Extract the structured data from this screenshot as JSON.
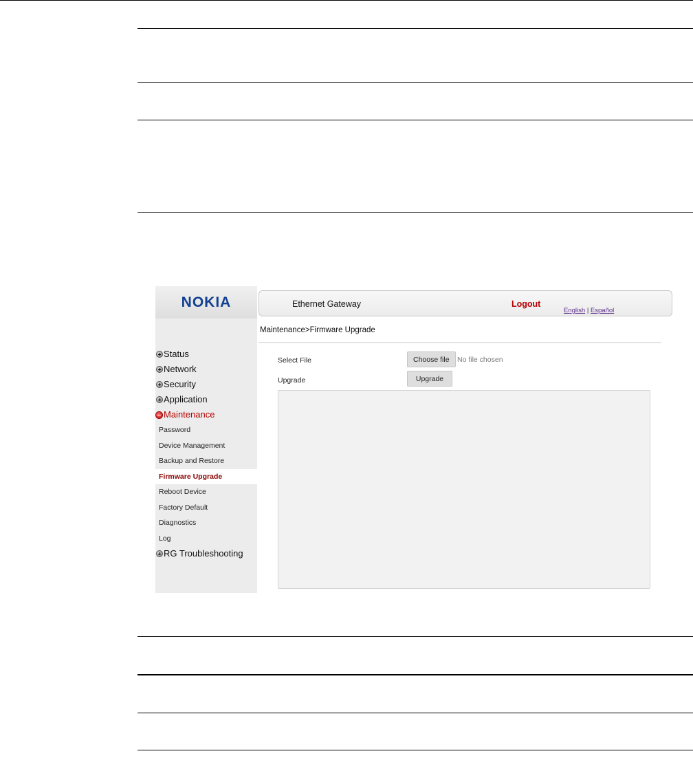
{
  "logo": "NOKIA",
  "header": {
    "title": "Ethernet Gateway",
    "logout": "Logout",
    "lang_english": "English",
    "lang_separator": "|",
    "lang_spanish": "Español"
  },
  "breadcrumb": "Maintenance>Firmware Upgrade",
  "sidebar": {
    "sections": [
      {
        "label": "Status"
      },
      {
        "label": "Network"
      },
      {
        "label": "Security"
      },
      {
        "label": "Application"
      },
      {
        "label": "Maintenance"
      },
      {
        "label": "RG Troubleshooting"
      }
    ],
    "maintenance_items": [
      {
        "label": "Password"
      },
      {
        "label": "Device Management"
      },
      {
        "label": "Backup and Restore"
      },
      {
        "label": "Firmware Upgrade"
      },
      {
        "label": "Reboot Device"
      },
      {
        "label": "Factory Default"
      },
      {
        "label": "Diagnostics"
      },
      {
        "label": "Log"
      }
    ]
  },
  "form": {
    "select_file_label": "Select File",
    "choose_file_button": "Choose file",
    "no_file_text": "No file chosen",
    "upgrade_label": "Upgrade",
    "upgrade_button": "Upgrade",
    "log_value": ""
  },
  "colors": {
    "logo_blue": "#124191",
    "active_red": "#b40000",
    "selected_item": "#8b0000"
  }
}
